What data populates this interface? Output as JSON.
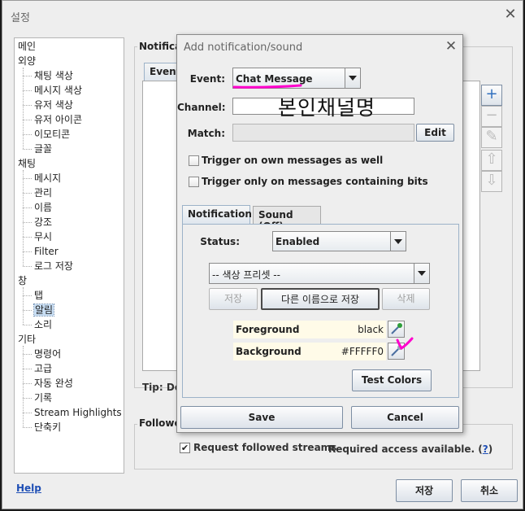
{
  "main_window": {
    "title": "설정",
    "close_glyph": "✕"
  },
  "sidebar": {
    "items": [
      {
        "label": "메인",
        "level": 0
      },
      {
        "label": "외양",
        "level": 0
      },
      {
        "label": "채팅 색상",
        "level": 1
      },
      {
        "label": "메시지 색상",
        "level": 1
      },
      {
        "label": "유저 색상",
        "level": 1
      },
      {
        "label": "유저 아이콘",
        "level": 1
      },
      {
        "label": "이모티콘",
        "level": 1
      },
      {
        "label": "글꼴",
        "level": 1
      },
      {
        "label": "채팅",
        "level": 0
      },
      {
        "label": "메시지",
        "level": 1
      },
      {
        "label": "관리",
        "level": 1
      },
      {
        "label": "이름",
        "level": 1
      },
      {
        "label": "강조",
        "level": 1
      },
      {
        "label": "무시",
        "level": 1
      },
      {
        "label": "Filter",
        "level": 1
      },
      {
        "label": "로그 저장",
        "level": 1
      },
      {
        "label": "창",
        "level": 0
      },
      {
        "label": "탭",
        "level": 1
      },
      {
        "label": "알림",
        "level": 1,
        "selected": true
      },
      {
        "label": "소리",
        "level": 1
      },
      {
        "label": "기타",
        "level": 0
      },
      {
        "label": "명령어",
        "level": 1
      },
      {
        "label": "고급",
        "level": 1
      },
      {
        "label": "자동 완성",
        "level": 1
      },
      {
        "label": "기록",
        "level": 1
      },
      {
        "label": "Stream Highlights",
        "level": 1
      },
      {
        "label": "단축키",
        "level": 1
      }
    ]
  },
  "notifications_panel": {
    "label": "Notificati",
    "events_tab": "Events",
    "tip_text": "Tip: Dou"
  },
  "side_buttons": [
    {
      "name": "add",
      "glyph": "+",
      "enabled": true
    },
    {
      "name": "remove",
      "glyph": "−",
      "enabled": false
    },
    {
      "name": "edit",
      "glyph": "✎",
      "enabled": false
    },
    {
      "name": "move-up",
      "glyph": "⇧",
      "enabled": false
    },
    {
      "name": "move-down",
      "glyph": "⇩",
      "enabled": false
    }
  ],
  "followed": {
    "label": "Followed",
    "checkbox_label": "Request followed streams",
    "checked": true,
    "check_glyph": "✔",
    "required_text": "Required access available.",
    "required_link": "?"
  },
  "footer": {
    "help": "Help",
    "save": "저장",
    "cancel": "취소"
  },
  "dialog": {
    "title": "Add notification/sound",
    "close_glyph": "✕",
    "event_label": "Event:",
    "event_value": "Chat Message",
    "channel_label": "Channel:",
    "channel_value": "",
    "channel_overlay_text": "본인채널명",
    "match_label": "Match:",
    "match_value": "",
    "edit_button": "Edit",
    "checkbox_own": "Trigger on own messages as well",
    "checkbox_bits": "Trigger only on messages containing bits",
    "tabs": [
      "Notification",
      "Sound (Off)"
    ],
    "status_label": "Status:",
    "status_value": "Enabled",
    "preset_value": "-- 색상 프리셋 --",
    "preset_buttons": {
      "save": "저장",
      "save_as": "다른 이름으로 저장",
      "delete": "삭제"
    },
    "foreground_label": "Foreground",
    "foreground_value": "black",
    "background_label": "Background",
    "background_value": "#FFFFF0",
    "test_colors": "Test Colors",
    "save_button": "Save",
    "cancel_button": "Cancel"
  },
  "colors": {
    "annotation": "#ff00cc",
    "link": "#1f4fb5",
    "selection": "#c7ddf3"
  }
}
